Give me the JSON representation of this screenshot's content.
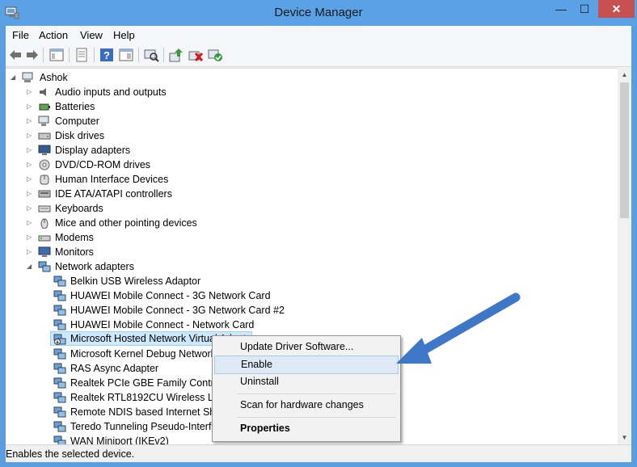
{
  "window": {
    "title": "Device Manager",
    "minimize_glyph": "—",
    "maximize_glyph": "☐",
    "close_glyph": "✕"
  },
  "menu": [
    "File",
    "Action",
    "View",
    "Help"
  ],
  "toolbar_icons": [
    "back-arrow-icon",
    "forward-arrow-icon",
    "show-hide-console-tree-icon",
    "properties-icon",
    "help-icon",
    "show-action-pane-icon",
    "scan-hardware-icon",
    "update-driver-icon",
    "uninstall-icon",
    "enable-device-icon"
  ],
  "tree": {
    "root": "Ashok",
    "categories": [
      "Audio inputs and outputs",
      "Batteries",
      "Computer",
      "Disk drives",
      "Display adapters",
      "DVD/CD-ROM drives",
      "Human Interface Devices",
      "IDE ATA/ATAPI controllers",
      "Keyboards",
      "Mice and other pointing devices",
      "Modems",
      "Monitors",
      "Network adapters"
    ],
    "network_adapters": [
      "Belkin USB Wireless Adaptor",
      "HUAWEI Mobile Connect - 3G Network Card",
      "HUAWEI Mobile Connect - 3G Network Card #2",
      "HUAWEI Mobile Connect - Network Card",
      "Microsoft Hosted Network Virtual Adapter",
      "Microsoft Kernel Debug Network Adapter",
      "RAS Async Adapter",
      "Realtek PCIe GBE Family Controller",
      "Realtek RTL8192CU Wireless LAN 802.11n USB 2.0 Network Adapter",
      "Remote NDIS based Internet Sharing Device",
      "Teredo Tunneling Pseudo-Interface",
      "WAN Miniport (IKEv2)"
    ]
  },
  "context_menu": {
    "update_driver": "Update Driver Software...",
    "enable": "Enable",
    "uninstall": "Uninstall",
    "scan": "Scan for hardware changes",
    "properties": "Properties"
  },
  "status": "Enables the selected device.",
  "colors": {
    "accent_arrow": "#3f77c8",
    "titlebar": "#5ba1e6",
    "close_button": "#c75050",
    "selection": "#cde8ff"
  }
}
